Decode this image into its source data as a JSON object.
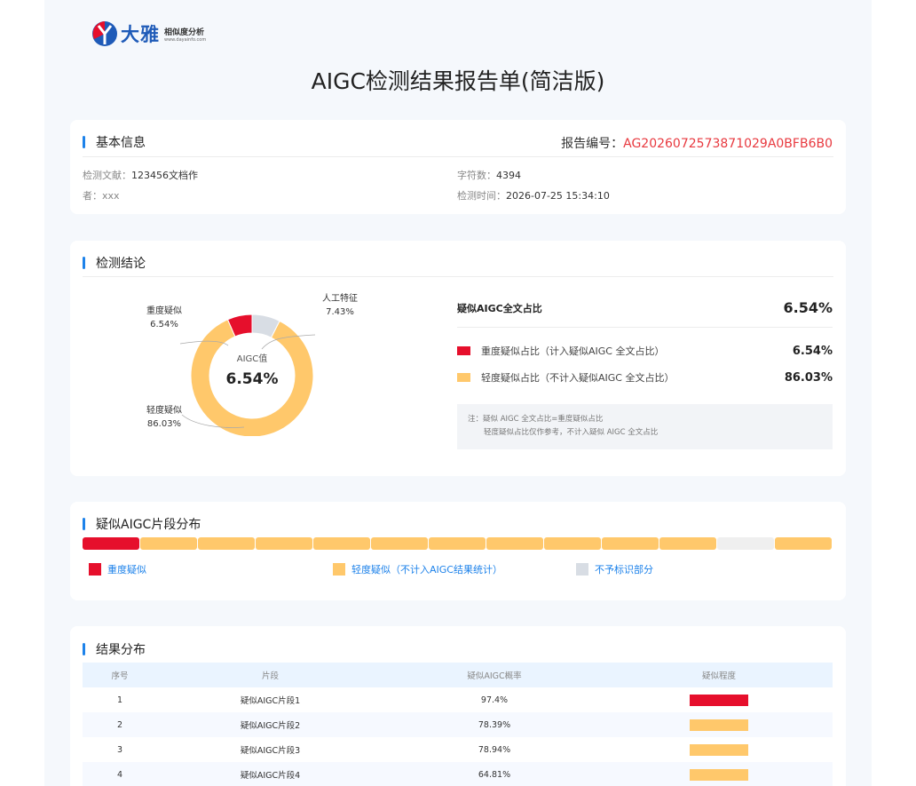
{
  "logo": {
    "name": "大雅",
    "sub": "相似度分析",
    "url": "www.dayainfo.com"
  },
  "title": "AIGC检测结果报告单(简洁版)",
  "basic_info": {
    "heading": "基本信息",
    "report_no_label": "报告编号：",
    "report_no": "AG2026072573871029A0BFB6B0",
    "doc_label": "检测文献：",
    "doc_value": "123456文档作",
    "author_label": "者：",
    "author_value": "xxx",
    "chars_label": "字符数：",
    "chars_value": "4394",
    "time_label": "检测时间：",
    "time_value": "2026-07-25 15:34:10"
  },
  "conclusion": {
    "heading": "检测结论",
    "donut_center_label": "AIGC值",
    "donut_center_value": "6.54%",
    "labels": {
      "heavy": {
        "name": "重度疑似",
        "pct": "6.54%"
      },
      "human": {
        "name": "人工特征",
        "pct": "7.43%"
      },
      "light": {
        "name": "轻度疑似",
        "pct": "86.03%"
      }
    },
    "ratio_title": "疑似AIGC全文占比",
    "ratio_value": "6.54%",
    "heavy_row": {
      "label": "重度疑似占比（计入疑似AIGC 全文占比）",
      "pct": "6.54%"
    },
    "light_row": {
      "label": "轻度疑似占比（不计入疑似AIGC 全文占比）",
      "pct": "86.03%"
    },
    "note_line1": "注：疑似 AIGC 全文占比=重度疑似占比",
    "note_line2": "轻度疑似占比仅作参考，不计入疑似 AIGC 全文占比"
  },
  "colors": {
    "heavy": "#e60f2c",
    "light": "#ffc86b",
    "none": "#d8dde4",
    "empty": "#efefef",
    "accent": "#1d82ea"
  },
  "chart_data": {
    "type": "pie",
    "categories": [
      "重度疑似",
      "人工特征",
      "轻度疑似"
    ],
    "values": [
      6.54,
      7.43,
      86.03
    ]
  },
  "distribution": {
    "heading": "疑似AIGC片段分布",
    "segments": [
      "heavy",
      "light",
      "light",
      "light",
      "light",
      "light",
      "light",
      "light",
      "light",
      "light",
      "light",
      "empty",
      "light"
    ],
    "legend": {
      "heavy": "重度疑似",
      "light": "轻度疑似（不计入AIGC结果统计）",
      "none": "不予标识部分"
    }
  },
  "results": {
    "heading": "结果分布",
    "columns": [
      "序号",
      "片段",
      "疑似AIGC概率",
      "疑似程度"
    ],
    "rows": [
      {
        "no": "1",
        "seg": "疑似AIGC片段1",
        "prob": "97.4%",
        "level": "heavy"
      },
      {
        "no": "2",
        "seg": "疑似AIGC片段2",
        "prob": "78.39%",
        "level": "light"
      },
      {
        "no": "3",
        "seg": "疑似AIGC片段3",
        "prob": "78.94%",
        "level": "light"
      },
      {
        "no": "4",
        "seg": "疑似AIGC片段4",
        "prob": "64.81%",
        "level": "light"
      }
    ]
  }
}
